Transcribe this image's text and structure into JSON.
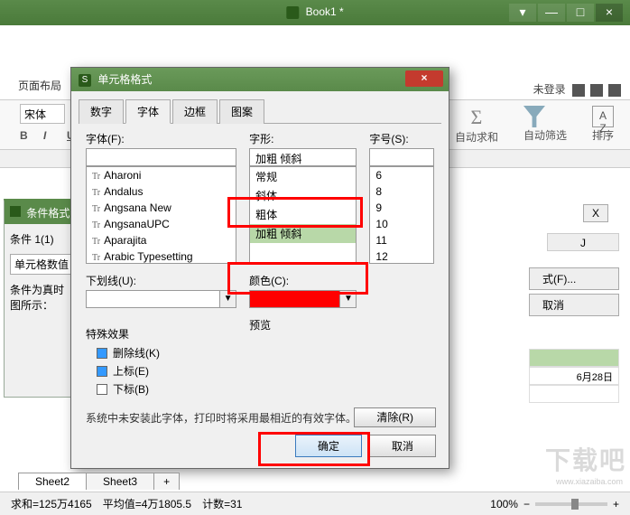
{
  "main": {
    "title": "Book1 *",
    "ribbon_tab": "页面布局",
    "not_logged": "未登录",
    "font_name": "宋体",
    "toolbar": {
      "bold": "B",
      "italic": "I",
      "underline": "U"
    },
    "ribbon_right": {
      "autosum": "自动求和",
      "autofilter": "自动筛选",
      "sort": "排序"
    }
  },
  "win_btns": {
    "menu": "▾",
    "min": "—",
    "max": "□",
    "close": "×"
  },
  "cf": {
    "title": "条件格式",
    "cond_label": "条件 1(1)",
    "cellval_btn": "单元格数值",
    "truth_text1": "条件为真时",
    "truth_text2": "图所示：",
    "close_x": "X",
    "format_btn": "式(F)...",
    "cancel_btn": "取消"
  },
  "grid": {
    "col": "J",
    "date": "6月28日"
  },
  "dialog": {
    "title": "单元格格式",
    "tabs": {
      "number": "数字",
      "font": "字体",
      "border": "边框",
      "pattern": "图案"
    },
    "labels": {
      "font": "字体(F):",
      "style": "字形:",
      "size": "字号(S):",
      "underline": "下划线(U):",
      "color": "颜色(C):",
      "effects": "特殊效果",
      "preview": "预览"
    },
    "style_selected": "加粗 倾斜",
    "fonts": [
      "Aharoni",
      "Andalus",
      "Angsana New",
      "AngsanaUPC",
      "Aparajita",
      "Arabic Typesetting"
    ],
    "styles": [
      "常规",
      "斜体",
      "粗体",
      "加粗 倾斜"
    ],
    "sizes": [
      "6",
      "8",
      "9",
      "10",
      "11",
      "12"
    ],
    "effects": {
      "strike": "删除线(K)",
      "super": "上标(E)",
      "sub": "下标(B)"
    },
    "note": "系统中未安装此字体，打印时将采用最相近的有效字体。",
    "clear": "清除(R)",
    "ok": "确定",
    "cancel": "取消",
    "icon_letter": "S"
  },
  "sheets": {
    "s2": "Sheet2",
    "s3": "Sheet3",
    "plus": "+"
  },
  "status": {
    "text": "求和=125万4165　平均值=4万1805.5　计数=31",
    "zoom": "100%",
    "minus": "−",
    "plus": "+"
  },
  "watermark": {
    "big": "下载吧",
    "small": "www.xiazaiba.com"
  }
}
